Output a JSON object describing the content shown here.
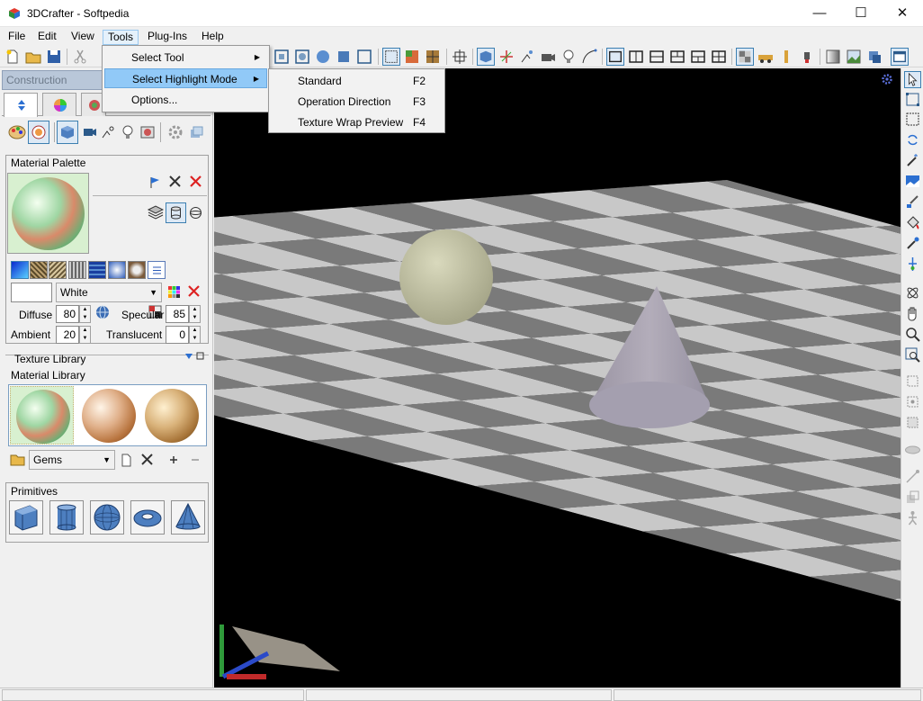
{
  "window": {
    "title": "3DCrafter - Softpedia",
    "minimize_glyph": "—",
    "maximize_glyph": "☐",
    "close_glyph": "✕"
  },
  "menubar": {
    "items": [
      "File",
      "Edit",
      "View",
      "Tools",
      "Plug-Ins",
      "Help"
    ]
  },
  "tools_menu": {
    "items": [
      {
        "label": "Select Tool",
        "has_submenu": true
      },
      {
        "label": "Select Highlight Mode",
        "has_submenu": true,
        "highlighted": true
      },
      {
        "label": "Options...",
        "has_submenu": false
      }
    ]
  },
  "highlight_submenu": {
    "items": [
      {
        "label": "Standard",
        "shortcut": "F2"
      },
      {
        "label": "Operation Direction",
        "shortcut": "F3"
      },
      {
        "label": "Texture Wrap Preview",
        "shortcut": "F4"
      }
    ]
  },
  "panel": {
    "header": "Construction",
    "material_palette": {
      "label": "Material Palette",
      "color_name": "White",
      "diffuse_label": "Diffuse",
      "diffuse": "80",
      "ambient_label": "Ambient",
      "ambient": "20",
      "specular_label": "Specular",
      "specular": "85",
      "translucent_label": "Translucent",
      "translucent": "0"
    },
    "texture_library_label": "Texture Library",
    "material_library": {
      "label": "Material Library",
      "category": "Gems"
    },
    "primitives": {
      "label": "Primitives",
      "items": [
        "cube",
        "cylinder",
        "sphere",
        "torus",
        "cone"
      ]
    }
  },
  "colors": {
    "viewport_bg": "#000000",
    "floor_light": "#c8c8c8",
    "floor_dark": "#7a7a7a",
    "sphere": "#c9c9aa",
    "cone": "#a9a3b0",
    "menu_highlight": "#91c9f7",
    "accent": "#3c7fb1"
  },
  "icons": {
    "app": "3dcrafter-logo-icon",
    "viewport_settings": "gear-icon"
  }
}
